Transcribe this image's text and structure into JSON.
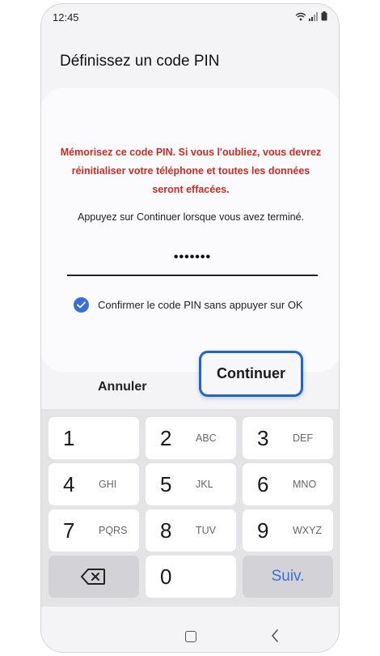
{
  "status_bar": {
    "time": "12:45",
    "icons": [
      "wifi-icon",
      "signal-icon",
      "battery-icon"
    ]
  },
  "header": {
    "title": "Définissez un code PIN"
  },
  "card": {
    "warning": "Mémorisez ce code PIN. Si vous l'oubliez, vous devrez réinitialiser votre téléphone et toutes les données seront effacées.",
    "instruction": "Appuyez sur Continuer lorsque vous avez terminé.",
    "pin_value": "•••••••",
    "confirm_checked": true,
    "confirm_label": "Confirmer le code PIN sans appuyer sur OK"
  },
  "actions": {
    "cancel_label": "Annuler",
    "continue_label": "Continuer"
  },
  "keypad": {
    "keys": [
      {
        "digit": "1",
        "letters": ""
      },
      {
        "digit": "2",
        "letters": "ABC"
      },
      {
        "digit": "3",
        "letters": "DEF"
      },
      {
        "digit": "4",
        "letters": "GHI"
      },
      {
        "digit": "5",
        "letters": "JKL"
      },
      {
        "digit": "6",
        "letters": "MNO"
      },
      {
        "digit": "7",
        "letters": "PQRS"
      },
      {
        "digit": "8",
        "letters": "TUV"
      },
      {
        "digit": "9",
        "letters": "WXYZ"
      }
    ],
    "zero": "0",
    "next_label": "Suiv."
  },
  "colors": {
    "warning": "#d22a21",
    "accent": "#3a6fd8",
    "highlight_border": "#1d64d4"
  }
}
